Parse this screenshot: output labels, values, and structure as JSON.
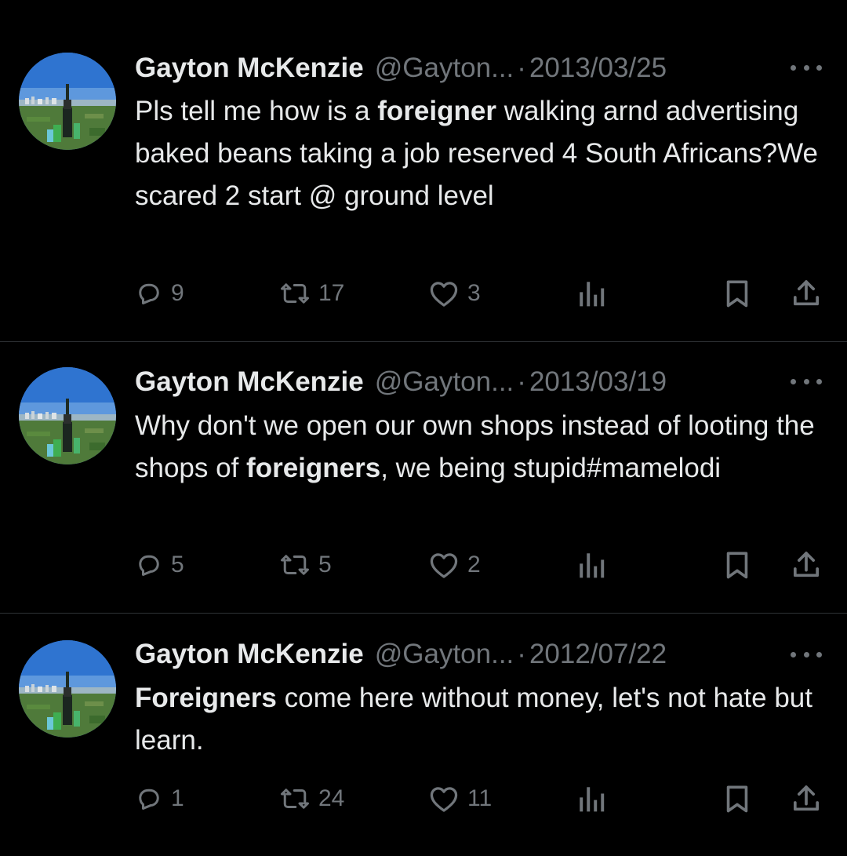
{
  "colors": {
    "background": "#000000",
    "text_primary": "#e7e9ea",
    "text_secondary": "#71767b",
    "divider": "#2f3336"
  },
  "icons": {
    "reply": "reply-icon",
    "retweet": "retweet-icon",
    "like": "like-icon",
    "views": "views-icon",
    "bookmark": "bookmark-icon",
    "share": "share-icon",
    "more": "more-icon"
  },
  "tweets": [
    {
      "author_name": "Gayton McKenzie",
      "handle": "@Gayton...",
      "separator": "·",
      "date": "2013/03/25",
      "text_parts": [
        "Pls tell me how is a ",
        "foreigner",
        " walking arnd advertising baked beans taking a job reserved 4 South Africans?We scared 2 start @ ground level"
      ],
      "replies": "9",
      "retweets": "17",
      "likes": "3"
    },
    {
      "author_name": "Gayton McKenzie",
      "handle": "@Gayton...",
      "separator": "·",
      "date": "2013/03/19",
      "text_parts": [
        "Why don't we open our own shops instead of looting the shops of ",
        "foreigners",
        ", we being stupid#mamelodi"
      ],
      "replies": "5",
      "retweets": "5",
      "likes": "2"
    },
    {
      "author_name": "Gayton McKenzie",
      "handle": "@Gayton...",
      "separator": "·",
      "date": "2012/07/22",
      "text_parts": [
        "",
        "Foreigners",
        " come here without money, let's not hate but learn."
      ],
      "replies": "1",
      "retweets": "24",
      "likes": "11"
    }
  ]
}
